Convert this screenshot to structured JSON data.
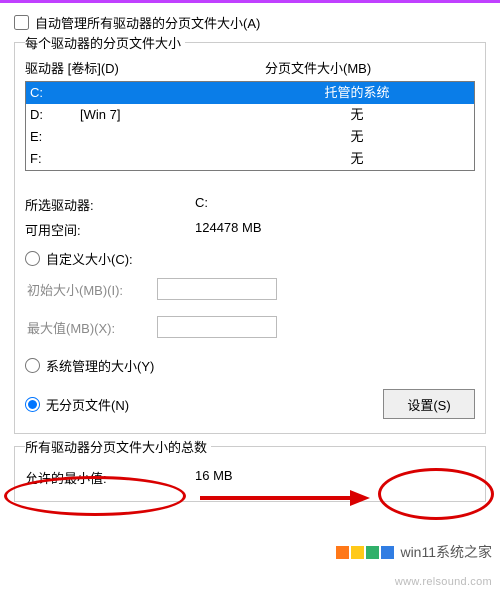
{
  "autoManage": {
    "label": "自动管理所有驱动器的分页文件大小(A)"
  },
  "group1": {
    "title": "每个驱动器的分页文件大小",
    "headers": {
      "drive": "驱动器 [卷标](D)",
      "size": "分页文件大小(MB)"
    },
    "rows": [
      {
        "drive": "C:",
        "label": "",
        "val": "托管的系统",
        "selected": true
      },
      {
        "drive": "D:",
        "label": "[Win 7]",
        "val": "无",
        "selected": false
      },
      {
        "drive": "E:",
        "label": "",
        "val": "无",
        "selected": false
      },
      {
        "drive": "F:",
        "label": "",
        "val": "无",
        "selected": false
      }
    ],
    "selDriveLabel": "所选驱动器:",
    "selDriveVal": "C:",
    "freeLabel": "可用空间:",
    "freeVal": "124478 MB",
    "radioCustom": "自定义大小(C):",
    "initialLabel": "初始大小(MB)(I):",
    "maxLabel": "最大值(MB)(X):",
    "radioSystem": "系统管理的大小(Y)",
    "radioNone": "无分页文件(N)",
    "setBtn": "设置(S)"
  },
  "group2": {
    "title": "所有驱动器分页文件大小的总数",
    "minLabel": "允许的最小值:",
    "minVal": "16 MB"
  },
  "brand": {
    "text": "win11系统之家",
    "tiles": [
      "#ff6a00",
      "#ffc400",
      "#1aa85a",
      "#1b6fe0"
    ]
  },
  "watermark": "www.relsound.com"
}
